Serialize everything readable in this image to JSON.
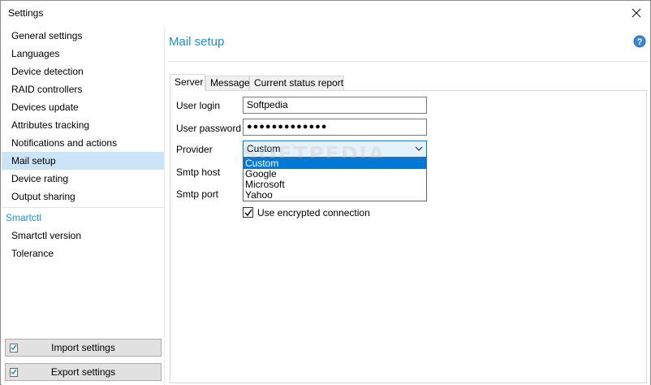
{
  "window": {
    "title": "Settings"
  },
  "sidebar": {
    "items": [
      {
        "label": "General settings"
      },
      {
        "label": "Languages"
      },
      {
        "label": "Device detection"
      },
      {
        "label": "RAID controllers"
      },
      {
        "label": "Devices update"
      },
      {
        "label": "Attributes tracking"
      },
      {
        "label": "Notifications and actions"
      },
      {
        "label": "Mail setup",
        "selected": true
      },
      {
        "label": "Device rating"
      },
      {
        "label": "Output sharing"
      }
    ],
    "section_header": "Smartctl",
    "section_items": [
      {
        "label": "Smartctl version"
      },
      {
        "label": "Tolerance"
      }
    ],
    "import_button": "Import settings",
    "export_button": "Export settings"
  },
  "main": {
    "title": "Mail setup",
    "tabs": [
      {
        "label": "Server",
        "active": true
      },
      {
        "label": "Message"
      },
      {
        "label": "Current status report"
      }
    ],
    "form": {
      "user_login_label": "User login",
      "user_login_value": "Softpedia",
      "user_password_label": "User password",
      "user_password_value": "●●●●●●●●●●●●●",
      "provider_label": "Provider",
      "provider_value": "Custom",
      "provider_options": [
        "Custom",
        "Google",
        "Microsoft",
        "Yahoo"
      ],
      "smtp_host_label": "Smtp host",
      "smtp_port_label": "Smtp port",
      "encrypted_label": "Use encrypted connection",
      "encrypted_checked": true
    }
  },
  "watermark": "SOFTPEDIA",
  "colors": {
    "accent": "#1e8fd6",
    "selection": "#cce4f7",
    "highlight": "#0078d7"
  },
  "icons": {
    "close": "close-icon",
    "help": "help-icon",
    "chevron": "chevron-down-icon"
  }
}
